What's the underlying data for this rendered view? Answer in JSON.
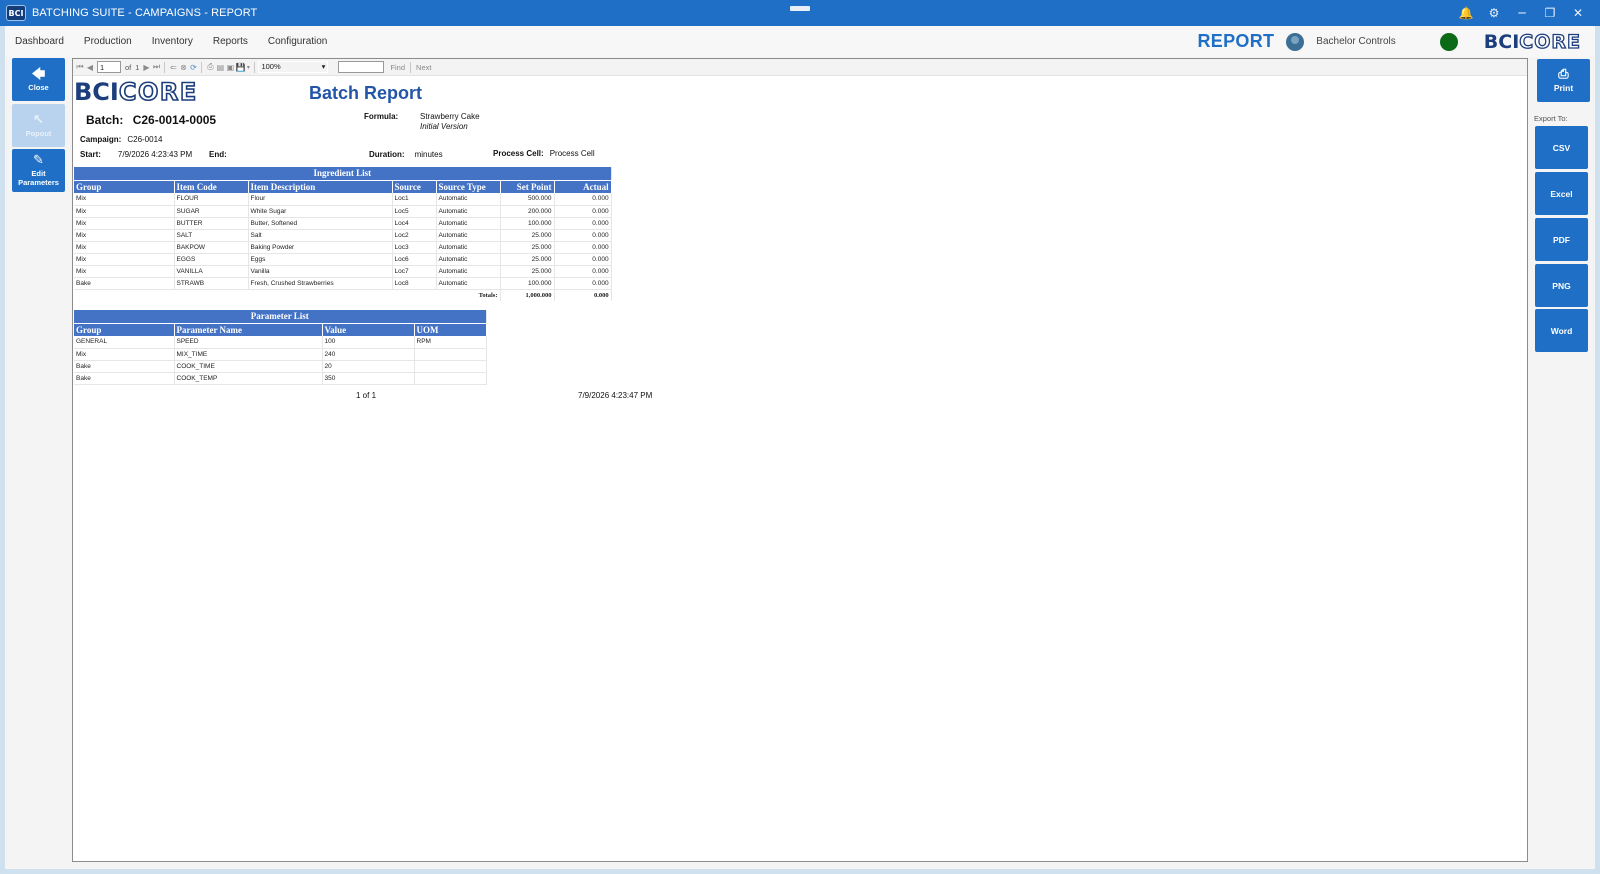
{
  "titlebar": {
    "app_logo": "BCI",
    "title": "BATCHING SUITE - CAMPAIGNS - REPORT"
  },
  "menu": {
    "items": [
      "Dashboard",
      "Production",
      "Inventory",
      "Reports",
      "Configuration"
    ],
    "page_label": "REPORT",
    "user_name": "Bachelor Controls",
    "logo_bci": "BCI",
    "logo_core": "CORE"
  },
  "left_sidebar": {
    "close_label": "Close",
    "popout_label": "Popout",
    "edit_label_1": "Edit",
    "edit_label_2": "Parameters"
  },
  "right_sidebar": {
    "print_label": "Print",
    "export_to_label": "Export To:",
    "csv_label": "CSV",
    "excel_label": "Excel",
    "pdf_label": "PDF",
    "png_label": "PNG",
    "word_label": "Word"
  },
  "viewer_toolbar": {
    "page_value": "1",
    "of_label": "of",
    "total_pages": "1",
    "zoom_value": "100%",
    "find_value": "",
    "find_label": "Find",
    "next_label": "Next"
  },
  "report": {
    "logo_bci": "BCI",
    "logo_core": "CORE",
    "title": "Batch Report",
    "batch_label": "Batch:",
    "batch_value": "C26-0014-0005",
    "formula_label": "Formula:",
    "formula_value": "Strawberry Cake",
    "formula_version": "Initial Version",
    "campaign_label": "Campaign:",
    "campaign_value": "C26-0014",
    "start_label": "Start:",
    "start_value": "7/9/2026 4:23:43 PM",
    "end_label": "End:",
    "end_value": "",
    "duration_label": "Duration:",
    "duration_value": "minutes",
    "process_cell_label": "Process Cell:",
    "process_cell_value": "Process Cell",
    "ingredients": {
      "caption": "Ingredient List",
      "headers": {
        "group": "Group",
        "item_code": "Item Code",
        "item_description": "Item Description",
        "source": "Source",
        "source_type": "Source Type",
        "set_point": "Set Point",
        "actual": "Actual"
      },
      "rows": [
        {
          "group": "Mix",
          "item_code": "FLOUR",
          "item_description": "Flour",
          "source": "Loc1",
          "source_type": "Automatic",
          "set_point": "500.000",
          "actual": "0.000"
        },
        {
          "group": "Mix",
          "item_code": "SUGAR",
          "item_description": "White Sugar",
          "source": "Loc5",
          "source_type": "Automatic",
          "set_point": "200.000",
          "actual": "0.000"
        },
        {
          "group": "Mix",
          "item_code": "BUTTER",
          "item_description": "Butter, Softened",
          "source": "Loc4",
          "source_type": "Automatic",
          "set_point": "100.000",
          "actual": "0.000"
        },
        {
          "group": "Mix",
          "item_code": "SALT",
          "item_description": "Salt",
          "source": "Loc2",
          "source_type": "Automatic",
          "set_point": "25.000",
          "actual": "0.000"
        },
        {
          "group": "Mix",
          "item_code": "BAKPOW",
          "item_description": "Baking Powder",
          "source": "Loc3",
          "source_type": "Automatic",
          "set_point": "25.000",
          "actual": "0.000"
        },
        {
          "group": "Mix",
          "item_code": "EGGS",
          "item_description": "Eggs",
          "source": "Loc6",
          "source_type": "Automatic",
          "set_point": "25.000",
          "actual": "0.000"
        },
        {
          "group": "Mix",
          "item_code": "VANILLA",
          "item_description": "Vanilla",
          "source": "Loc7",
          "source_type": "Automatic",
          "set_point": "25.000",
          "actual": "0.000"
        },
        {
          "group": "Bake",
          "item_code": "STRAWB",
          "item_description": "Fresh, Crushed Strawberries",
          "source": "Loc8",
          "source_type": "Automatic",
          "set_point": "100.000",
          "actual": "0.000"
        }
      ],
      "totals_label": "Totals:",
      "total_set_point": "1,000.000",
      "total_actual": "0.000"
    },
    "parameters": {
      "caption": "Parameter List",
      "headers": {
        "group": "Group",
        "parameter_name": "Parameter Name",
        "value": "Value",
        "uom": "UOM"
      },
      "rows": [
        {
          "group": "GENERAL",
          "parameter_name": "SPEED",
          "value": "100",
          "uom": "RPM"
        },
        {
          "group": "Mix",
          "parameter_name": "MIX_TIME",
          "value": "240",
          "uom": ""
        },
        {
          "group": "Bake",
          "parameter_name": "COOK_TIME",
          "value": "20",
          "uom": ""
        },
        {
          "group": "Bake",
          "parameter_name": "COOK_TEMP",
          "value": "350",
          "uom": ""
        }
      ]
    },
    "footer_page": "1 of 1",
    "footer_timestamp": "7/9/2026 4:23:47 PM"
  },
  "colors": {
    "accent": "#1f6fc6",
    "table_header": "#4472c4",
    "status_ok": "#0b6a16"
  },
  "icons": {
    "close": "arrow-left-icon",
    "popout": "popout-arrow-icon",
    "edit": "pencil-icon",
    "print": "printer-icon"
  }
}
